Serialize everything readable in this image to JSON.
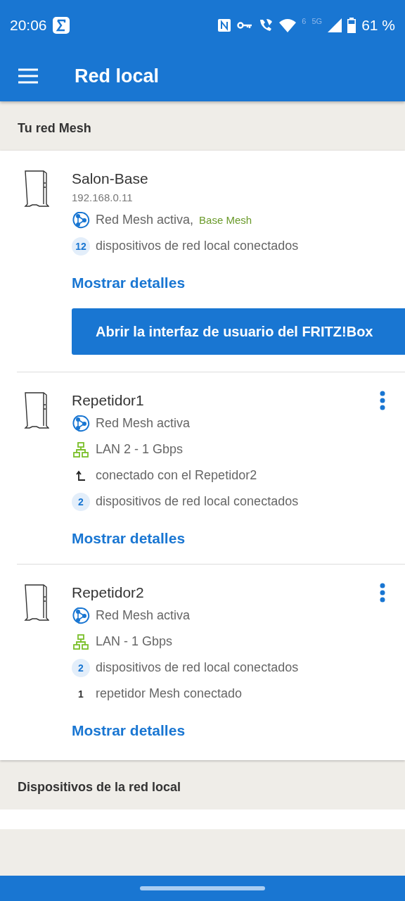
{
  "status_bar": {
    "time": "20:06",
    "network": "5G",
    "wifi_badge": "6",
    "battery": "61 %"
  },
  "app_bar": {
    "title": "Red local"
  },
  "sections": [
    {
      "title": "Tu red Mesh",
      "devices": [
        {
          "name": "Salon-Base",
          "address": "192.168.0.11",
          "menu": false,
          "lines": [
            {
              "kind": "mesh",
              "text": "Red Mesh activa,",
              "note": "Base Mesh"
            },
            {
              "kind": "count",
              "badge": "12",
              "text": "dispositivos de red local conectados"
            }
          ],
          "link": "Mostrar detalles",
          "action": "Abrir la interfaz de usuario del FRITZ!Box"
        },
        {
          "name": "Repetidor1",
          "menu": true,
          "lines": [
            {
              "kind": "mesh",
              "text": "Red Mesh activa"
            },
            {
              "kind": "lan",
              "text": "LAN 2 - 1 Gbps"
            },
            {
              "kind": "uplink",
              "text": "conectado con el Repetidor2"
            },
            {
              "kind": "count",
              "badge": "2",
              "text": "dispositivos de red local conectados"
            }
          ],
          "link": "Mostrar detalles"
        },
        {
          "name": "Repetidor2",
          "menu": true,
          "lines": [
            {
              "kind": "mesh",
              "text": "Red Mesh activa"
            },
            {
              "kind": "lan",
              "text": "LAN - 1 Gbps"
            },
            {
              "kind": "count",
              "badge": "2",
              "text": "dispositivos de red local conectados"
            },
            {
              "kind": "number",
              "badge": "1",
              "text": "repetidor Mesh conectado"
            }
          ],
          "link": "Mostrar detalles"
        }
      ]
    },
    {
      "title": "Dispositivos de la red local"
    }
  ]
}
